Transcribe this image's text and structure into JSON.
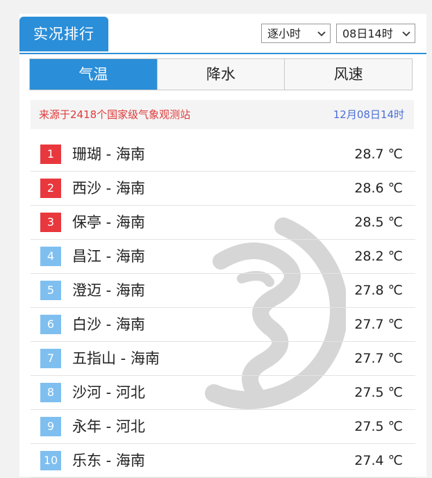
{
  "header": {
    "title": "实况排行",
    "mode_select": "逐小时",
    "time_select": "08日14时"
  },
  "tabs": [
    {
      "label": "气温",
      "active": true
    },
    {
      "label": "降水",
      "active": false
    },
    {
      "label": "风速",
      "active": false
    }
  ],
  "source": {
    "text": "来源于2418个国家级气象观测站",
    "time": "12月08日14时"
  },
  "rows": [
    {
      "rank": "1",
      "name": "珊瑚 - 海南",
      "value": "28.7 ℃"
    },
    {
      "rank": "2",
      "name": "西沙 - 海南",
      "value": "28.6 ℃"
    },
    {
      "rank": "3",
      "name": "保亭 - 海南",
      "value": "28.5 ℃"
    },
    {
      "rank": "4",
      "name": "昌江 - 海南",
      "value": "28.2 ℃"
    },
    {
      "rank": "5",
      "name": "澄迈 - 海南",
      "value": "27.8 ℃"
    },
    {
      "rank": "6",
      "name": "白沙 - 海南",
      "value": "27.7 ℃"
    },
    {
      "rank": "7",
      "name": "五指山 - 海南",
      "value": "27.7 ℃"
    },
    {
      "rank": "8",
      "name": "沙河 - 河北",
      "value": "27.5 ℃"
    },
    {
      "rank": "9",
      "name": "永年 - 河北",
      "value": "27.5 ℃"
    },
    {
      "rank": "10",
      "name": "乐东 - 海南",
      "value": "27.4 ℃"
    }
  ],
  "colors": {
    "accent": "#2b8ed8",
    "top_rank": "#e8383d",
    "other_rank": "#7fbff0",
    "source_text": "#e03a3a",
    "source_time": "#4a6fd8"
  },
  "icons": {
    "dropdown": "chevron-down-icon",
    "watermark": "dragon-logo-watermark"
  }
}
